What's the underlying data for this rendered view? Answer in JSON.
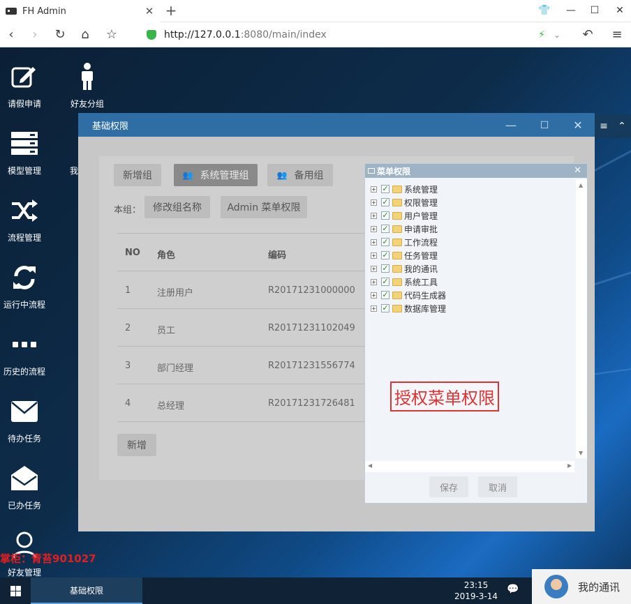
{
  "browser": {
    "tab_title": "FH Admin",
    "tab_close": "✕",
    "new_tab": "+",
    "url_host": "http://127.0.0.1",
    "url_rest": ":8080/main/index"
  },
  "desktop_icons": [
    {
      "label": "请假申请",
      "icon": "edit-icon"
    },
    {
      "label": "好友分组",
      "icon": "person-icon"
    },
    {
      "label": "模型管理",
      "icon": "server-icon"
    },
    {
      "label": "我",
      "icon": "person-icon"
    },
    {
      "label": "流程管理",
      "icon": "shuffle-icon"
    },
    {
      "label": "运行中流程",
      "icon": "refresh-icon"
    },
    {
      "label": "历史的流程",
      "icon": "ellipsis-icon"
    },
    {
      "label": "待办任务",
      "icon": "envelope-icon"
    },
    {
      "label": "已办任务",
      "icon": "envelope-open-icon"
    },
    {
      "label": "好友管理",
      "icon": "user-icon"
    }
  ],
  "dialog": {
    "title": "基础权限",
    "groups": {
      "new_group": "新增组",
      "system_group": "系统管理组",
      "backup_group": "备用组"
    },
    "this_group_label": "本组：",
    "rename_button": "修改组名称",
    "admin_menu_button": "Admin 菜单权限",
    "table": {
      "headers": [
        "NO",
        "角色",
        "编码"
      ],
      "rows": [
        [
          "1",
          "注册用户",
          "R20171231000000"
        ],
        [
          "2",
          "员工",
          "R20171231102049"
        ],
        [
          "3",
          "部门经理",
          "R20171231556774"
        ],
        [
          "4",
          "总经理",
          "R20171231726481"
        ]
      ]
    },
    "add_button": "新增"
  },
  "menu_popup": {
    "title": "菜单权限",
    "items": [
      "系统管理",
      "权限管理",
      "用户管理",
      "申请审批",
      "工作流程",
      "任务管理",
      "我的通讯",
      "系统工具",
      "代码生成器",
      "数据库管理"
    ],
    "annotation": "授权菜单权限",
    "save": "保存",
    "cancel": "取消"
  },
  "watermark": "掌柜：青苔901027",
  "taskbar": {
    "active_item": "基础权限",
    "time": "23:15",
    "date": "2019-3-14",
    "contact": "我的通讯"
  },
  "colors": {
    "dialog_header": "#2f6ea5",
    "check": "#1a8a1a",
    "annotation": "#d33333"
  }
}
